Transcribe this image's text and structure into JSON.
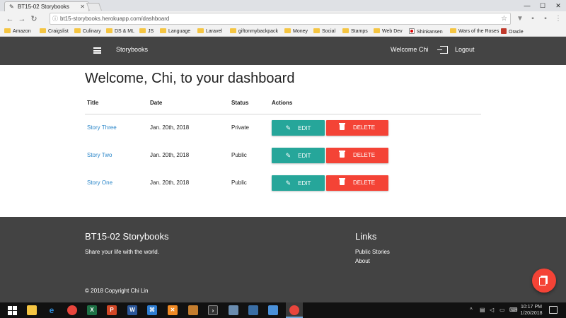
{
  "browser": {
    "tab_title": "BT15-02 Storybooks",
    "url": "bt15-storybooks.herokuapp.com/dashboard",
    "bookmarks": [
      {
        "label": "Amazon",
        "icon": "amazon-icon"
      },
      {
        "label": "Craigslist",
        "icon": "folder-icon"
      },
      {
        "label": "Culinary",
        "icon": "folder-icon"
      },
      {
        "label": "DS & ML",
        "icon": "folder-icon"
      },
      {
        "label": "JS",
        "icon": "folder-icon"
      },
      {
        "label": "Language",
        "icon": "folder-icon"
      },
      {
        "label": "Laravel",
        "icon": "folder-icon"
      },
      {
        "label": "giftonmybackpack",
        "icon": "folder-icon"
      },
      {
        "label": "Money",
        "icon": "folder-icon"
      },
      {
        "label": "Social",
        "icon": "folder-icon"
      },
      {
        "label": "Stamps",
        "icon": "folder-icon"
      },
      {
        "label": "Web Dev",
        "icon": "folder-icon"
      },
      {
        "label": "Shinkansen",
        "icon": "shinkansen-icon"
      },
      {
        "label": "Wars of the Roses",
        "icon": "folder-icon"
      },
      {
        "label": "Oracle",
        "icon": "oracle-icon"
      }
    ]
  },
  "nav": {
    "brand": "Storybooks",
    "welcome": "Welcome Chi",
    "logout": "Logout"
  },
  "dashboard": {
    "heading": "Welcome, Chi, to your dashboard",
    "columns": [
      "Title",
      "Date",
      "Status",
      "Actions"
    ],
    "rows": [
      {
        "title": "Story Three",
        "date": "Jan. 20th, 2018",
        "status": "Private"
      },
      {
        "title": "Story Two",
        "date": "Jan. 20th, 2018",
        "status": "Public"
      },
      {
        "title": "Story One",
        "date": "Jan. 20th, 2018",
        "status": "Public"
      }
    ],
    "edit_label": "EDIT",
    "delete_label": "DELETE"
  },
  "footer": {
    "title": "BT15-02 Storybooks",
    "tagline": "Share your life with the world.",
    "links_heading": "Links",
    "links": [
      "Public Stories",
      "About"
    ],
    "copyright": "© 2018 Copyright Chi Lin"
  },
  "taskbar": {
    "time": "10:17 PM",
    "date": "1/20/2018"
  },
  "colors": {
    "navbar": "#444444",
    "edit": "#26a69a",
    "delete": "#f44336",
    "link": "#2a86c9"
  }
}
